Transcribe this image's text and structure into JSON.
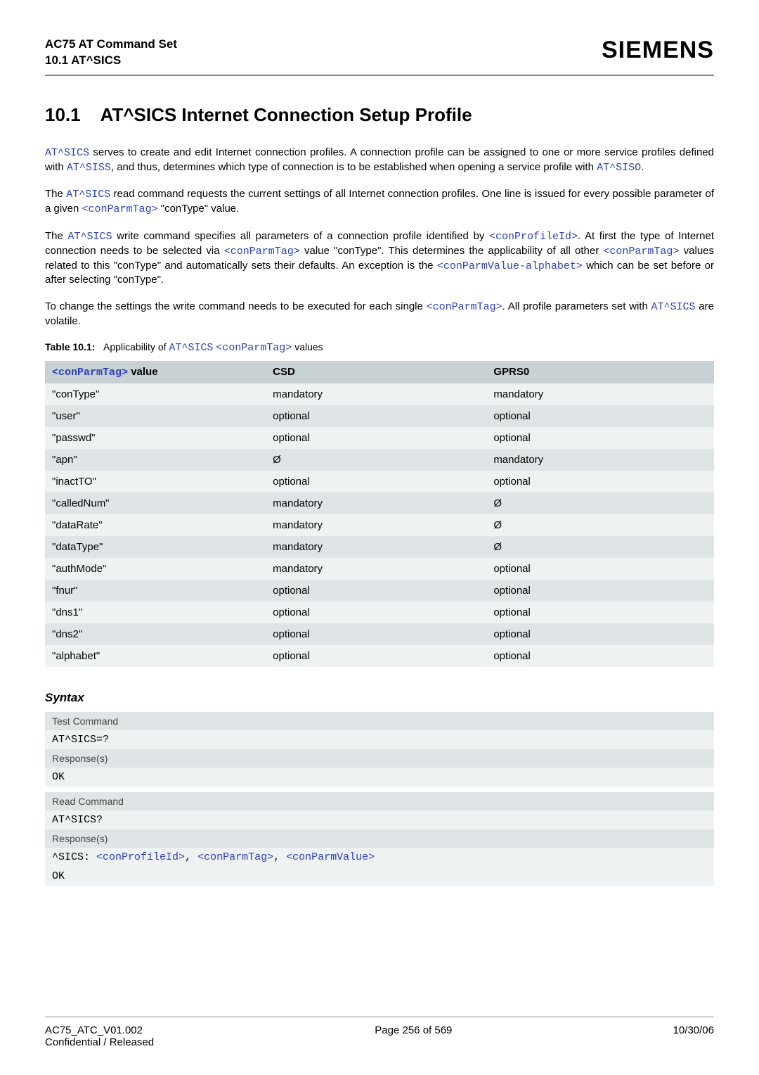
{
  "header": {
    "title": "AC75 AT Command Set",
    "subtitle": "10.1 AT^SICS",
    "logo": "SIEMENS"
  },
  "section": {
    "number": "10.1",
    "title": "AT^SICS   Internet Connection Setup Profile"
  },
  "body": {
    "p1_a": "AT^SICS",
    "p1_b": " serves to create and edit Internet connection profiles. A connection profile can be assigned to one or more service profiles defined with ",
    "p1_c": "AT^SISS",
    "p1_d": ", and thus, determines which type of connection is to be established when opening a service profile with ",
    "p1_e": "AT^SISO",
    "p1_f": ".",
    "p2_a": "The ",
    "p2_b": "AT^SICS",
    "p2_c": " read command requests the current settings of all Internet connection profiles. One line is issued for every possible parameter of a given ",
    "p2_d": "<conParmTag>",
    "p2_e": " \"conType\" value.",
    "p3_a": "The ",
    "p3_b": "AT^SICS",
    "p3_c": " write command specifies all parameters of a connection profile identified by ",
    "p3_d": "<conProfileId>",
    "p3_e": ". At first the type of Internet connection needs to be selected via ",
    "p3_f": "<conParmTag>",
    "p3_g": " value \"conType\". This determines the applicability of all other ",
    "p3_h": "<conParmTag>",
    "p3_i": " values related to this \"conType\" and automatically sets their defaults. An exception is the ",
    "p3_j": "<conParmValue-alphabet>",
    "p3_k": " which can be set before or after selecting \"conType\".",
    "p4_a": "To change the settings the write command needs to be executed for each single ",
    "p4_b": "<conParmTag>",
    "p4_c": ". All profile parameters set with ",
    "p4_d": "AT^SICS",
    "p4_e": " are volatile."
  },
  "tableCaption": {
    "label": "Table 10.1:",
    "text_a": "Applicability of ",
    "text_b": "AT^SICS",
    "text_c": " ",
    "text_d": "<conParmTag>",
    "text_e": " values"
  },
  "table": {
    "headers": {
      "h1a": "<conParmTag>",
      "h1b": " value",
      "h2": "CSD",
      "h3": "GPRS0"
    },
    "rows": [
      {
        "c1": "\"conType\"",
        "c2": "mandatory",
        "c3": "mandatory"
      },
      {
        "c1": "\"user\"",
        "c2": "optional",
        "c3": "optional"
      },
      {
        "c1": "\"passwd\"",
        "c2": "optional",
        "c3": "optional"
      },
      {
        "c1": "\"apn\"",
        "c2": "Ø",
        "c3": "mandatory"
      },
      {
        "c1": "\"inactTO\"",
        "c2": "optional",
        "c3": "optional"
      },
      {
        "c1": "\"calledNum\"",
        "c2": "mandatory",
        "c3": "Ø"
      },
      {
        "c1": "\"dataRate\"",
        "c2": "mandatory",
        "c3": "Ø"
      },
      {
        "c1": "\"dataType\"",
        "c2": "mandatory",
        "c3": "Ø"
      },
      {
        "c1": "\"authMode\"",
        "c2": "mandatory",
        "c3": "optional"
      },
      {
        "c1": "\"fnur\"",
        "c2": "optional",
        "c3": "optional"
      },
      {
        "c1": "\"dns1\"",
        "c2": "optional",
        "c3": "optional"
      },
      {
        "c1": "\"dns2\"",
        "c2": "optional",
        "c3": "optional"
      },
      {
        "c1": "\"alphabet\"",
        "c2": "optional",
        "c3": "optional"
      }
    ]
  },
  "syntax": {
    "heading": "Syntax",
    "testLabel": "Test Command",
    "testCmd": "AT^SICS=?",
    "respLabel1": "Response(s)",
    "ok1": "OK",
    "readLabel": "Read Command",
    "readCmd": "AT^SICS?",
    "respLabel2": "Response(s)",
    "sics_a": "^SICS: ",
    "sics_b": "<conProfileId>",
    "sics_c": ", ",
    "sics_d": "<conParmTag>",
    "sics_e": ", ",
    "sics_f": "<conParmValue>",
    "ok2": "OK"
  },
  "footer": {
    "left1": "AC75_ATC_V01.002",
    "left2": "Confidential / Released",
    "center": "Page 256 of 569",
    "right": "10/30/06"
  }
}
